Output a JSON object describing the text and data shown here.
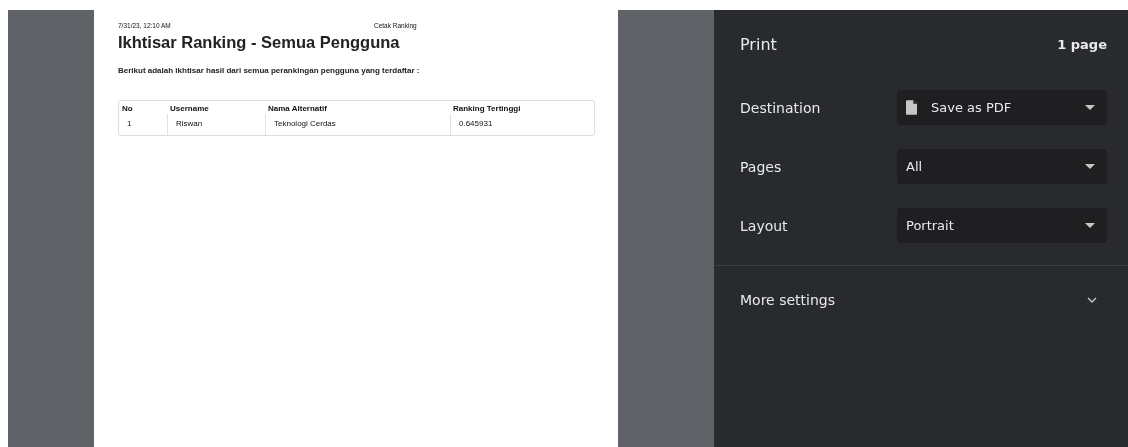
{
  "preview": {
    "header_date": "7/31/23, 12:10 AM",
    "header_title": "Cetak Ranking",
    "title": "Ikhtisar Ranking - Semua Pengguna",
    "intro": "Berikut adalah ikhtisar hasil dari semua perankingan pengguna yang terdaftar :",
    "table": {
      "columns": [
        "No",
        "Username",
        "Nama Alternatif",
        "Ranking Tertinggi"
      ],
      "rows": [
        [
          "1",
          "Riswan",
          "Teknologi Cerdas",
          "0.645931"
        ]
      ]
    }
  },
  "panel": {
    "title": "Print",
    "page_count": "1 page",
    "settings": [
      {
        "label": "Destination",
        "value": "Save as PDF",
        "kind": "file"
      },
      {
        "label": "Pages",
        "value": "All",
        "kind": "plain"
      },
      {
        "label": "Layout",
        "value": "Portrait",
        "kind": "plain"
      }
    ],
    "more_settings": {
      "label": "More settings",
      "expanded": false
    }
  }
}
